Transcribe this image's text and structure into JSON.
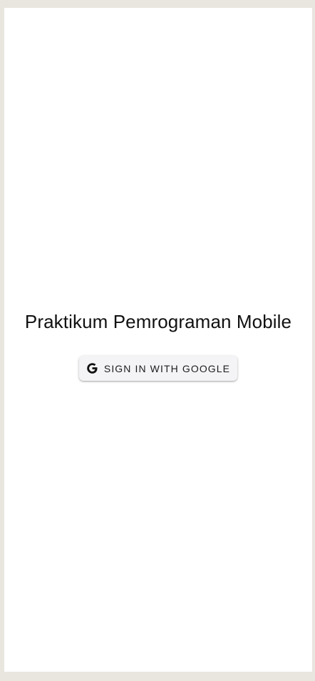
{
  "app": {
    "title": "Praktikum Pemrograman Mobile"
  },
  "signin": {
    "label": "SIGN IN WITH GOOGLE",
    "icon": "google-icon"
  },
  "colors": {
    "background": "#e9e5df",
    "surface": "#ffffff",
    "button": "#f4f4f6",
    "text": "#111111"
  }
}
